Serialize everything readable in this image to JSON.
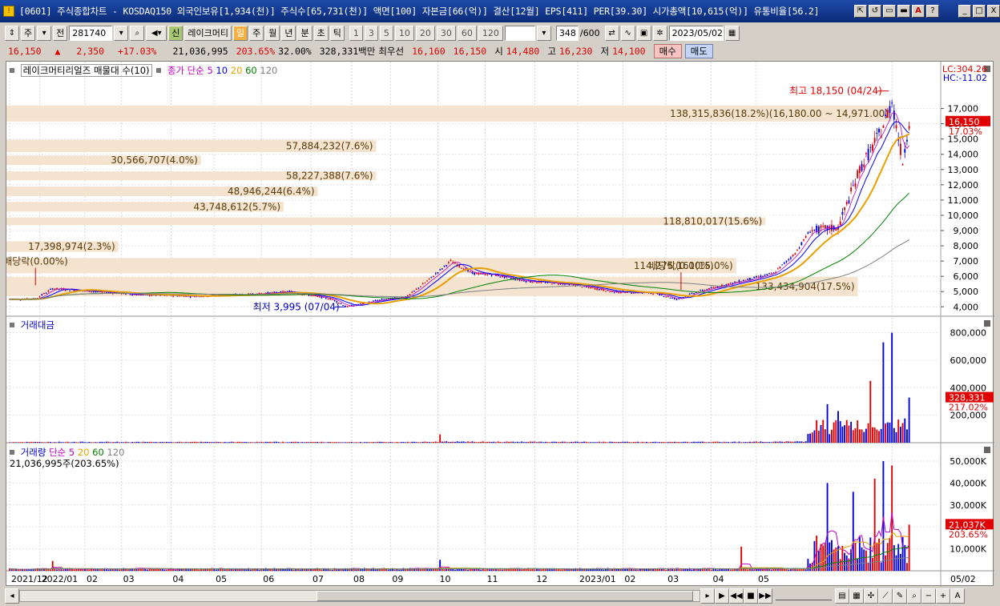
{
  "window": {
    "title": "[0601] 주식종합차트 - KOSDAQ150 외국인보유[1,934(천)] 주식수[65,731(천)] 액면[100] 자본금[66(억)] 결산[12월] EPS[411] PER[39.30] 시가총액[10,615(억)] 유통비율[56.2]",
    "app_icon_glyph": "!",
    "window_buttons": [
      "⇱",
      "↺",
      "▭",
      "▬",
      "A",
      "?"
    ],
    "control_buttons": [
      "_",
      "□",
      "X"
    ]
  },
  "toolbar": {
    "type_label": "주",
    "prev_label": "전",
    "code": "281740",
    "new_label": "신",
    "stock_name": "레이크머티",
    "periods": [
      "일",
      "주",
      "월",
      "년",
      "분",
      "초",
      "틱"
    ],
    "intervals": [
      "1",
      "3",
      "5",
      "10",
      "20",
      "30",
      "60",
      "120"
    ],
    "count": "348",
    "count_max": "/600",
    "date": "2023/05/02"
  },
  "quote": {
    "price": "16,150",
    "arrow": "▲",
    "change": "2,350",
    "change_pct": "+17.03%",
    "volume": "21,036,995",
    "vol_ratio": "203.65%",
    "turnover": "32.00%",
    "amount": "328,331백만",
    "best_label": "최우선",
    "bid": "16,160",
    "ask": "16,150",
    "open_label": "시",
    "open": "14,480",
    "high_label": "고",
    "high": "16,230",
    "low_label": "저",
    "low": "14,100",
    "buy_label": "매수",
    "sell_label": "매도"
  },
  "price_panel": {
    "title": "레이크머티리얼즈 매물대 수(10)",
    "ma_title": "종가 단순",
    "ma_periods": [
      "5",
      "10",
      "20",
      "60",
      "120"
    ],
    "ma_colors": [
      "#c000c0",
      "#0000ff",
      "#e8a000",
      "#008000",
      "#808080"
    ],
    "lc_label": "LC:304.26",
    "hc_label": "HC:-11.02",
    "high_marker": "최고 18,150 (04/24)",
    "low_marker": "최저 3,995 (07/04)",
    "current_price": "16,150",
    "current_pct": "17.03%",
    "dividend_labels": [
      "배당락(0.00%)",
      "배당락(0.00%)"
    ],
    "axis_ticks": [
      "17,000",
      "16,000",
      "15,000",
      "14,000",
      "13,000",
      "12,000",
      "11,000",
      "10,000",
      "9,000",
      "8,000",
      "7,000",
      "6,000",
      "5,000",
      "4,000"
    ],
    "volume_profile": [
      {
        "label": "138,315,836(18.2%)(16,180.00 ~ 14,971.00)",
        "share": 18.2
      },
      {
        "label": "57,884,232(7.6%)",
        "share": 7.6
      },
      {
        "label": "30,566,707(4.0%)",
        "share": 4.0
      },
      {
        "label": "58,227,388(7.6%)",
        "share": 7.6
      },
      {
        "label": "48,946,244(6.4%)",
        "share": 6.4
      },
      {
        "label": "43,748,612(5.7%)",
        "share": 5.7
      },
      {
        "label": "118,810,017(15.6%)",
        "share": 15.6
      },
      {
        "label": "17,398,974(2.3%)",
        "share": 2.3
      },
      {
        "label": "114,275,161(15.0%)",
        "share": 15.0
      },
      {
        "label": "133,434,904(17.5%)",
        "share": 17.5
      }
    ]
  },
  "amount_panel": {
    "title": "거래대금",
    "axis_ticks": [
      "800,000",
      "600,000",
      "400,000",
      "200,000"
    ],
    "current": "328,331",
    "current_pct": "217.02%"
  },
  "volume_panel": {
    "title": "거래량",
    "ma_title": "단순",
    "ma_periods": [
      "5",
      "20",
      "60",
      "120"
    ],
    "ma_colors": [
      "#c000c0",
      "#e8a000",
      "#008000",
      "#808080"
    ],
    "sub": "21,036,995주(203.65%)",
    "axis_ticks": [
      "50,000K",
      "40,000K",
      "30,000K",
      "20,000K",
      "10,000K"
    ],
    "current": "21,037K",
    "current_pct": "203.65%"
  },
  "x_axis": [
    "2021/12",
    "2022/01",
    "02",
    "03",
    "04",
    "05",
    "06",
    "07",
    "08",
    "09",
    "10",
    "11",
    "12",
    "2023/01",
    "02",
    "03",
    "04",
    "05",
    "05/02"
  ],
  "colors": {
    "up": "#e00000",
    "down": "#0000e0",
    "profile_bg": "#f3e3cf",
    "title_bar": "#0a2a78"
  },
  "chart_data": {
    "type": "candlestick",
    "title": "레이크머티리얼즈",
    "ylim": [
      3700,
      18500
    ],
    "price_path": [
      {
        "x": 0,
        "y": 4500
      },
      {
        "x": 12,
        "y": 4520
      },
      {
        "x": 20,
        "y": 5200
      },
      {
        "x": 30,
        "y": 5100
      },
      {
        "x": 45,
        "y": 4950
      },
      {
        "x": 60,
        "y": 4800
      },
      {
        "x": 85,
        "y": 4700
      },
      {
        "x": 110,
        "y": 4800
      },
      {
        "x": 130,
        "y": 5000
      },
      {
        "x": 150,
        "y": 4500
      },
      {
        "x": 157,
        "y": 4000
      },
      {
        "x": 170,
        "y": 4400
      },
      {
        "x": 185,
        "y": 4700
      },
      {
        "x": 195,
        "y": 5800
      },
      {
        "x": 205,
        "y": 7000
      },
      {
        "x": 215,
        "y": 6200
      },
      {
        "x": 225,
        "y": 6100
      },
      {
        "x": 240,
        "y": 5700
      },
      {
        "x": 260,
        "y": 5500
      },
      {
        "x": 280,
        "y": 5000
      },
      {
        "x": 300,
        "y": 4900
      },
      {
        "x": 310,
        "y": 4500
      },
      {
        "x": 320,
        "y": 5000
      },
      {
        "x": 340,
        "y": 5700
      },
      {
        "x": 355,
        "y": 6200
      },
      {
        "x": 365,
        "y": 7500
      },
      {
        "x": 372,
        "y": 9000
      },
      {
        "x": 385,
        "y": 9200
      },
      {
        "x": 395,
        "y": 13000
      },
      {
        "x": 405,
        "y": 15500
      },
      {
        "x": 410,
        "y": 17500
      },
      {
        "x": 415,
        "y": 13500
      },
      {
        "x": 418,
        "y": 16150
      }
    ],
    "amount_spikes": [
      {
        "x": 200,
        "v": 60000
      },
      {
        "x": 380,
        "v": 280000
      },
      {
        "x": 385,
        "v": 230000
      },
      {
        "x": 400,
        "v": 450000
      },
      {
        "x": 406,
        "v": 730000
      },
      {
        "x": 410,
        "v": 800000
      },
      {
        "x": 418,
        "v": 328331
      }
    ],
    "volume_spikes": [
      {
        "x": 20,
        "v": 4500
      },
      {
        "x": 200,
        "v": 5000
      },
      {
        "x": 340,
        "v": 11000
      },
      {
        "x": 380,
        "v": 40000
      },
      {
        "x": 392,
        "v": 36000
      },
      {
        "x": 402,
        "v": 42000
      },
      {
        "x": 406,
        "v": 50000
      },
      {
        "x": 410,
        "v": 48000
      },
      {
        "x": 418,
        "v": 21037
      }
    ]
  }
}
